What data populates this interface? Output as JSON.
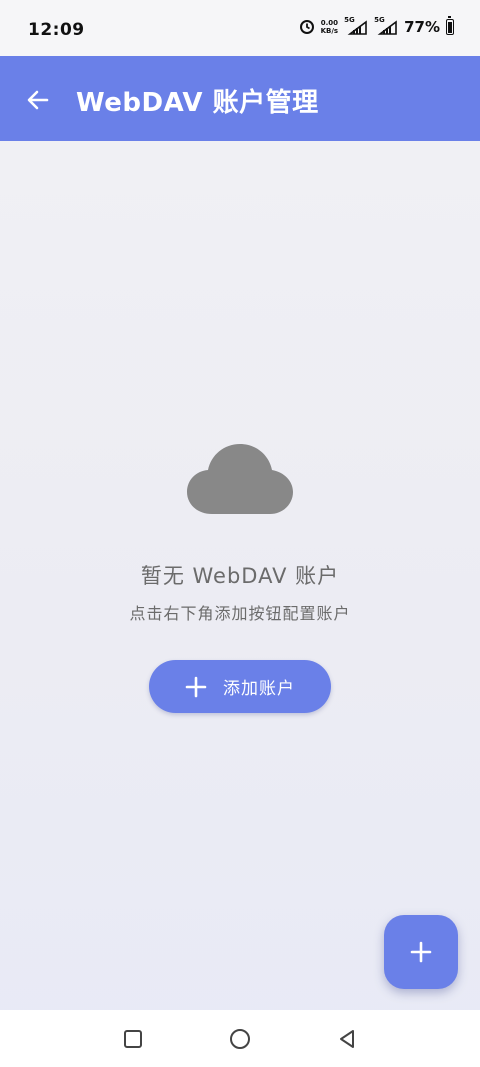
{
  "status_bar": {
    "time": "12:09",
    "net_speed_value": "0.00",
    "net_speed_unit": "KB/s",
    "sim1_label": "5G",
    "sim2_label": "5G",
    "battery_percent": "77%",
    "battery_level": 0.77,
    "icons": [
      "alarm-clock-icon",
      "signal-icon",
      "signal-icon",
      "battery-icon"
    ]
  },
  "app_bar": {
    "back_icon": "arrow-left-icon",
    "title": "WebDAV 账户管理",
    "color": "#6a80e8"
  },
  "empty_state": {
    "icon": "cloud-icon",
    "title": "暂无 WebDAV 账户",
    "subtitle": "点击右下角添加按钮配置账户",
    "add_button_icon": "plus-icon",
    "add_button_label": "添加账户"
  },
  "fab": {
    "icon": "plus-icon"
  },
  "nav_bar": {
    "icons": [
      "square-icon",
      "circle-icon",
      "triangle-back-icon"
    ]
  }
}
